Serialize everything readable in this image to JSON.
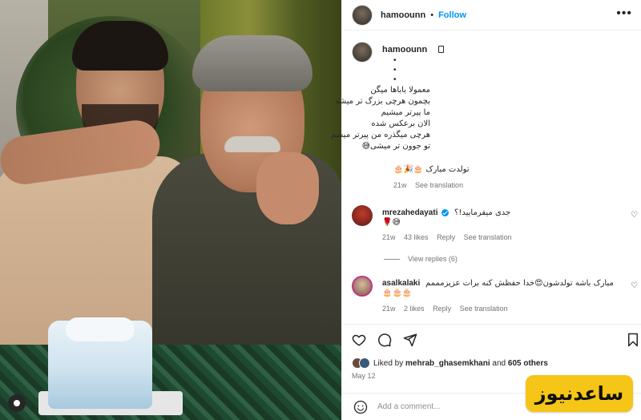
{
  "post": {
    "username": "hamoounn",
    "follow_label": "Follow",
    "dot": "•"
  },
  "caption": {
    "username": "hamoounn",
    "dots": [
      "•",
      "•",
      "•"
    ],
    "lines": [
      "معمولا باباها میگن",
      "بچمون هرچی بزرگ تر میشه",
      "ما پیرتر میشیم",
      "الان برعکس شده",
      "هرچی میگذره من پیرتر میشم",
      "تو جوون تر میشی😅"
    ],
    "birthday": "تولدت مبارک 🎂🎉🎂",
    "time": "21w",
    "see_translation": "See translation"
  },
  "comments": [
    {
      "username": "mrezahedayati",
      "verified": true,
      "text": "جدی میفرمایید!؟",
      "text2": "😅🌹",
      "time": "21w",
      "likes": "43 likes",
      "reply": "Reply",
      "see_translation": "See translation"
    },
    {
      "username": "asalkalaki",
      "verified": false,
      "text": "مبارک باشه تولدشون😍خدا حفظش کنه برات عزیزمممم",
      "text2": "🎂🎂🎂",
      "time": "21w",
      "likes": "2 likes",
      "reply": "Reply",
      "see_translation": "See translation"
    }
  ],
  "view_replies": "View replies (6)",
  "likes": {
    "prefix": "Liked by",
    "user": "mehrab_ghasemkhani",
    "and": "and",
    "others": "605 others"
  },
  "date": "May 12",
  "add_comment": {
    "placeholder": "Add a comment..."
  },
  "watermark": {
    "text": "ساعدنیوز",
    "color": "#f5c518"
  },
  "icons": {
    "like": "heart-icon",
    "comment": "comment-icon",
    "share": "share-icon",
    "save": "bookmark-icon",
    "emoji": "emoji-icon",
    "more": "more-icon"
  },
  "colors": {
    "accent": "#0095f6",
    "muted": "#737373"
  }
}
